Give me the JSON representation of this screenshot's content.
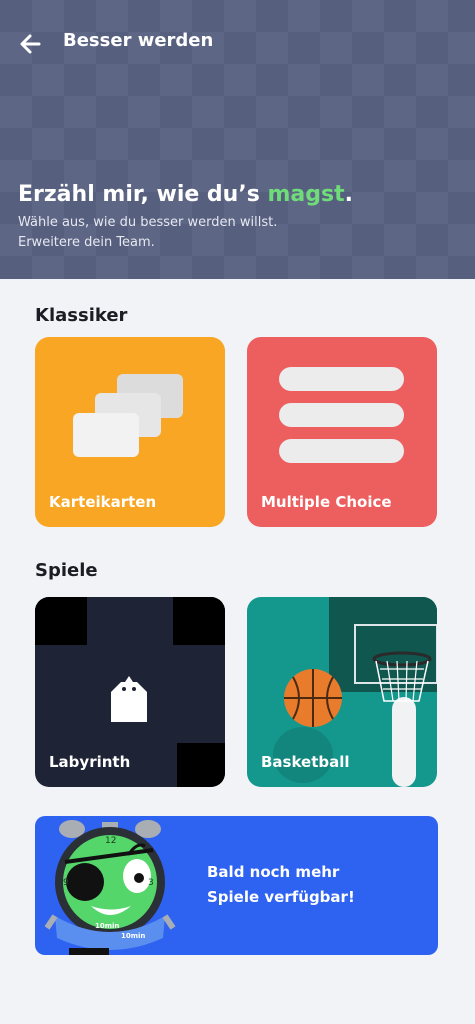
{
  "topbar": {
    "title": "Besser werden",
    "back_icon": "arrow-left-icon"
  },
  "hero": {
    "headline_before": "Erzähl mir, wie du’s ",
    "headline_accent": "magst",
    "headline_after": ".",
    "subtitle_line1": "Wähle aus, wie du besser werden willst.",
    "subtitle_line2": "Erweitere dein Team.",
    "accent_color": "#6fdc7a",
    "background_color": "#575f7f"
  },
  "sections": {
    "klassiker": {
      "title": "Klassiker",
      "cards": [
        {
          "label": "Karteikarten",
          "color": "#f8a623",
          "icon": "flashcards-icon"
        },
        {
          "label": "Multiple Choice",
          "color": "#ed5e5e",
          "icon": "answer-options-icon"
        }
      ]
    },
    "spiele": {
      "title": "Spiele",
      "cards": [
        {
          "label": "Labyrinth",
          "color": "#1f2336",
          "icon": "ghost-icon"
        },
        {
          "label": "Basketball",
          "color": "#14988e",
          "icon": "basketball-hoop-icon"
        }
      ]
    }
  },
  "banner": {
    "line1": "Bald noch mehr",
    "line2": "Spiele verfügbar!",
    "color": "#2e62f0",
    "mascot_icon": "pirate-clock-mascot-icon",
    "clock_number_top": "12",
    "clock_number_right": "3",
    "clock_number_left": "9",
    "ribbon_text_1": "10min",
    "ribbon_text_2": "10min"
  }
}
